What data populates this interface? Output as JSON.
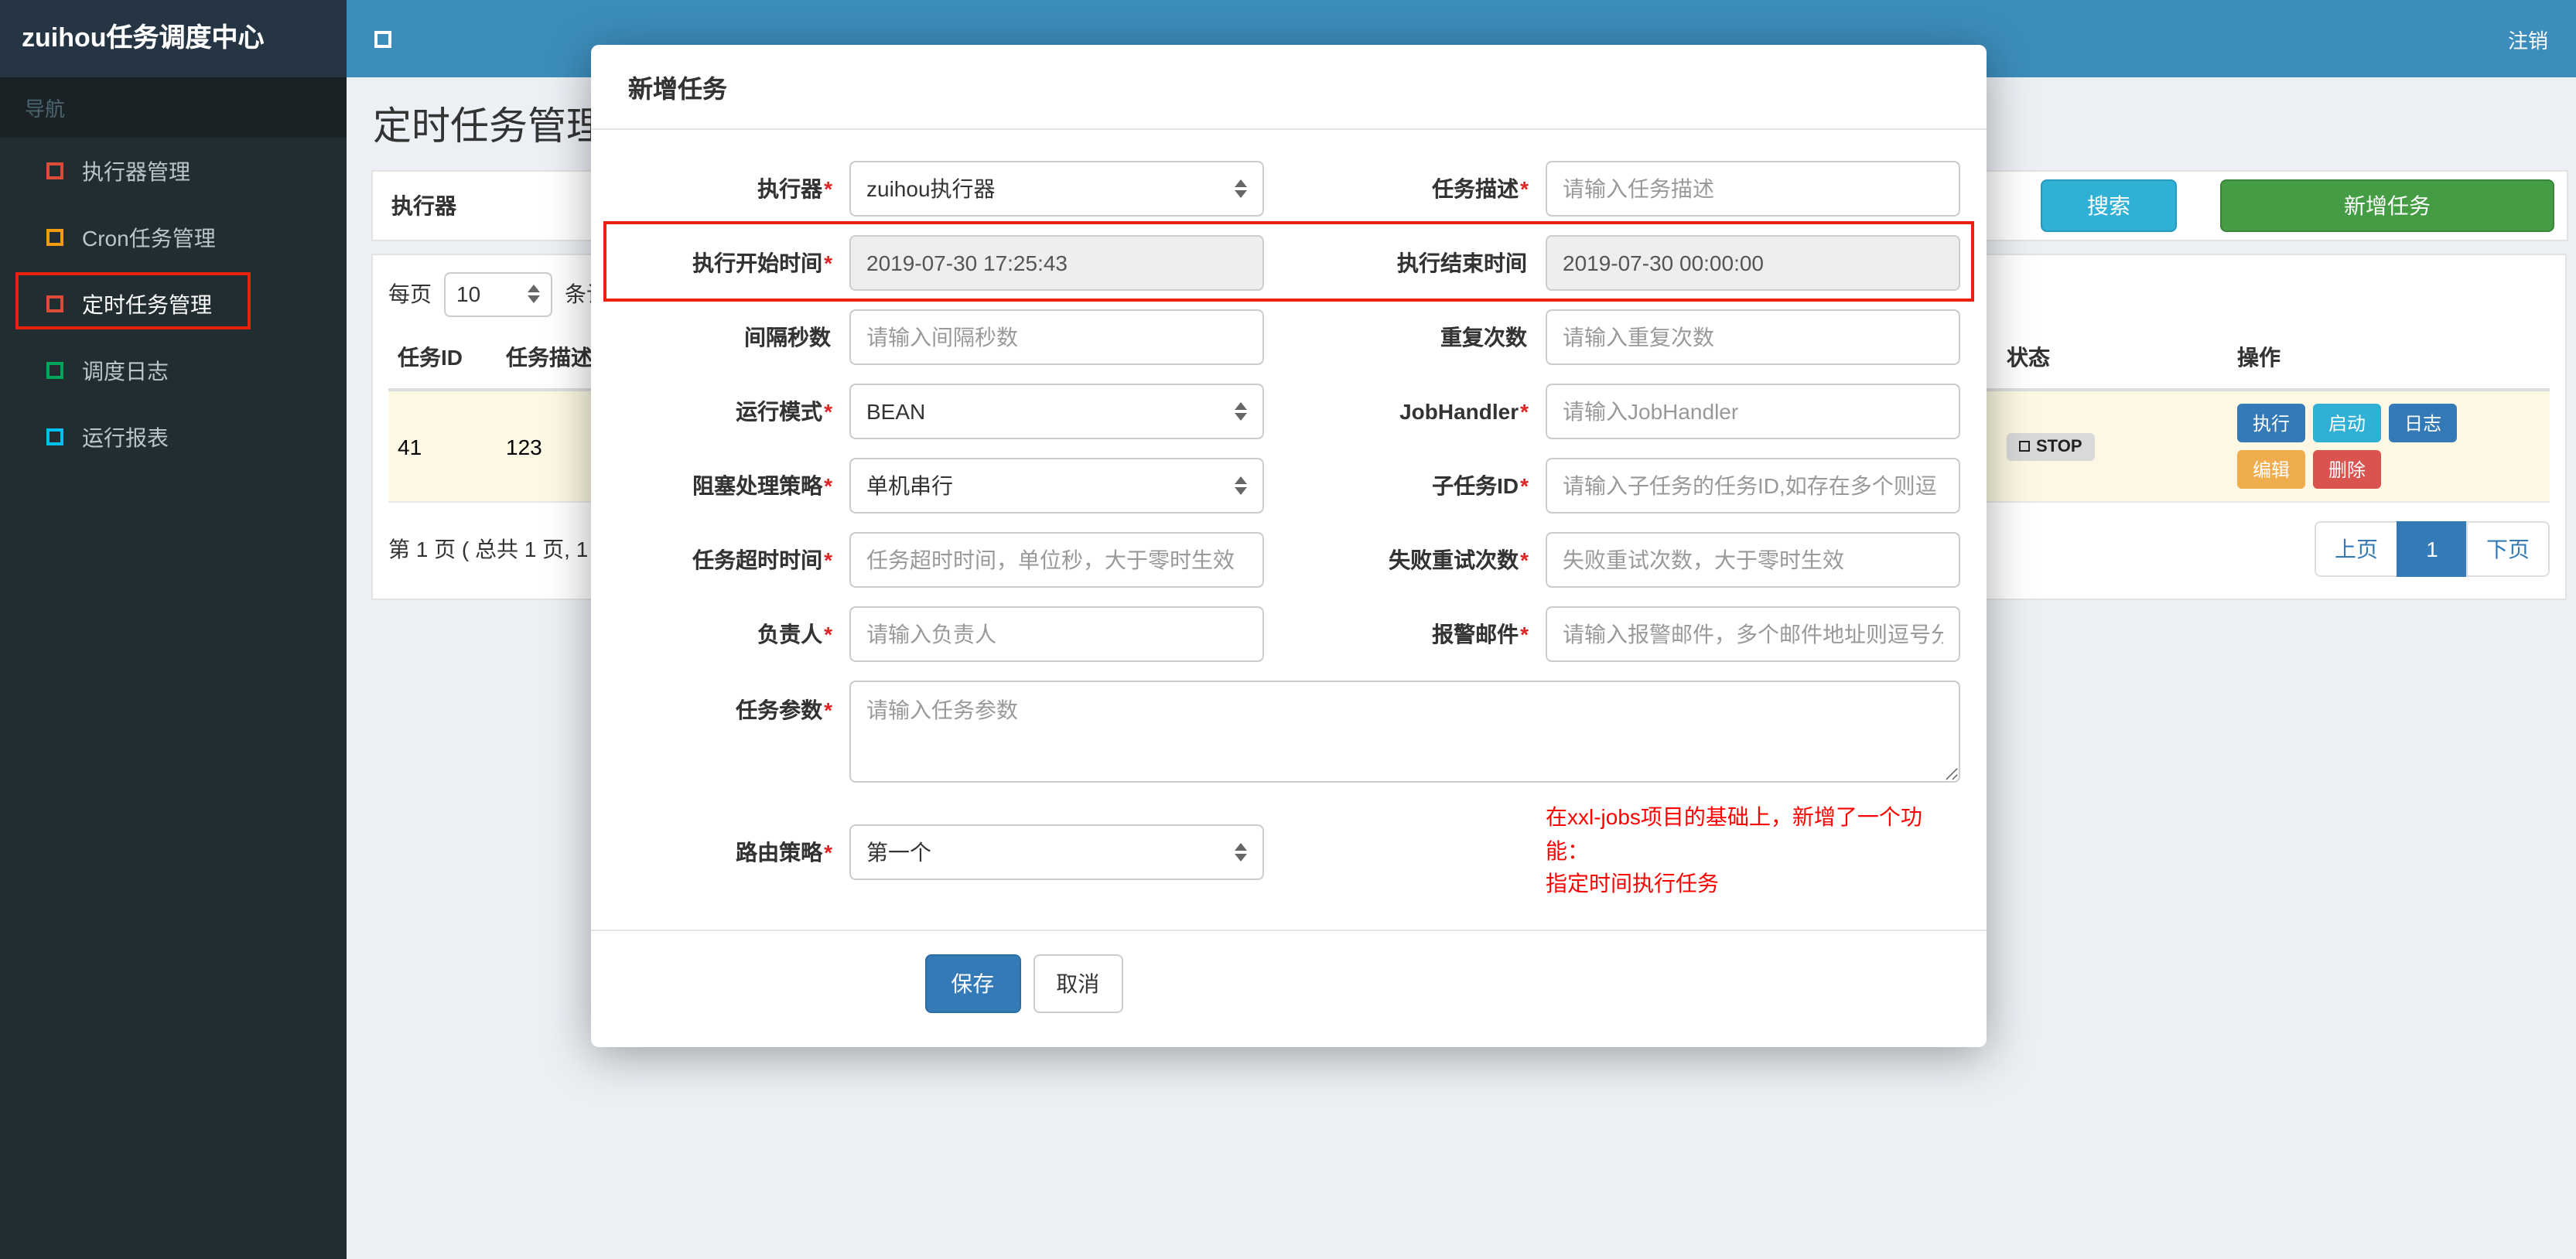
{
  "header": {
    "brand": "zuihou任务调度中心",
    "logout_label": "注销"
  },
  "sidebar": {
    "nav_header": "导航",
    "items": [
      {
        "label": "执行器管理",
        "icon_color": "#dd4b39"
      },
      {
        "label": "Cron任务管理",
        "icon_color": "#f39c12"
      },
      {
        "label": "定时任务管理",
        "icon_color": "#dd4b39",
        "active": true
      },
      {
        "label": "调度日志",
        "icon_color": "#00a65a"
      },
      {
        "label": "运行报表",
        "icon_color": "#00c0ef"
      }
    ]
  },
  "page": {
    "title": "定时任务管理",
    "filter": {
      "executor_label": "执行器",
      "search_button": "搜索",
      "add_button": "新增任务"
    },
    "per_page": {
      "prefix": "每页",
      "size": "10",
      "suffix": "条记"
    },
    "table": {
      "headers": {
        "job_id": "任务ID",
        "job_desc": "任务描述",
        "status": "状态",
        "actions": "操作"
      },
      "row": {
        "job_id": "41",
        "job_desc": "123",
        "status": "STOP",
        "actions": {
          "run": "执行",
          "start": "启动",
          "log": "日志",
          "edit": "编辑",
          "delete": "删除"
        }
      }
    },
    "pagination": {
      "info": "第 1 页 ( 总共 1 页, 1",
      "prev": "上页",
      "current": "1",
      "next": "下页"
    }
  },
  "modal": {
    "title": "新增任务",
    "fields": {
      "executor": {
        "label": "执行器",
        "req": "*",
        "value": "zuihou执行器"
      },
      "job_desc": {
        "label": "任务描述",
        "req": "*",
        "placeholder": "请输入任务描述"
      },
      "start_time": {
        "label": "执行开始时间",
        "req": "*",
        "value": "2019-07-30 17:25:43"
      },
      "end_time": {
        "label": "执行结束时间",
        "req": "",
        "value": "2019-07-30 00:00:00"
      },
      "interval": {
        "label": "间隔秒数",
        "req": "",
        "placeholder": "请输入间隔秒数"
      },
      "repeat_count": {
        "label": "重复次数",
        "req": "",
        "placeholder": "请输入重复次数"
      },
      "run_mode": {
        "label": "运行模式",
        "req": "*",
        "value": "BEAN"
      },
      "job_handler": {
        "label": "JobHandler",
        "req": "*",
        "placeholder": "请输入JobHandler"
      },
      "block_strategy": {
        "label": "阻塞处理策略",
        "req": "*",
        "value": "单机串行"
      },
      "child_job_id": {
        "label": "子任务ID",
        "req": "*",
        "placeholder": "请输入子任务的任务ID,如存在多个则逗"
      },
      "timeout": {
        "label": "任务超时时间",
        "req": "*",
        "placeholder": "任务超时时间，单位秒，大于零时生效"
      },
      "fail_retry": {
        "label": "失败重试次数",
        "req": "*",
        "placeholder": "失败重试次数，大于零时生效"
      },
      "owner": {
        "label": "负责人",
        "req": "*",
        "placeholder": "请输入负责人"
      },
      "alarm_email": {
        "label": "报警邮件",
        "req": "*",
        "placeholder": "请输入报警邮件，多个邮件地址则逗号分"
      },
      "job_params": {
        "label": "任务参数",
        "req": "*",
        "placeholder": "请输入任务参数"
      },
      "route_strategy": {
        "label": "路由策略",
        "req": "*",
        "value": "第一个"
      }
    },
    "note_line1": "在xxl-jobs项目的基础上，新增了一个功能：",
    "note_line2": "指定时间执行任务",
    "save_button": "保存",
    "cancel_button": "取消"
  },
  "colors": {
    "header-blue": "#3c8dbc",
    "brand-dark": "#253544",
    "sidebar-dark": "#222d32",
    "accent-blue": "#337ab7",
    "success-green": "#449d44",
    "info-teal": "#31b0d5",
    "warning-orange": "#f0ad4e",
    "danger-red": "#d9534f",
    "annotation-red": "#e8220d",
    "row-highlight": "#fcf8e3"
  }
}
